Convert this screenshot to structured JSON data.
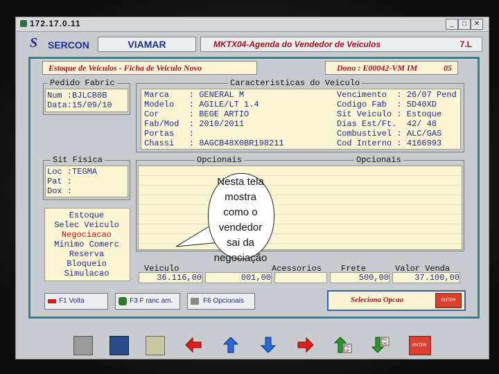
{
  "titlebar": {
    "text": "172.17.0.11",
    "min": "_",
    "max": "□",
    "close": "✕"
  },
  "app": {
    "logo_mark": "S",
    "logo_text": "SERCON",
    "company": "VIAMAR",
    "screen_title": "MKTX04-Agenda do Vendedor de Veiculos",
    "version": "7.L"
  },
  "header": {
    "ficha": "Estoque de Veiculos - Ficha de Veiculo Novo",
    "dono": "Dono : E00042-VM IM",
    "dono_num": "05"
  },
  "pedido": {
    "legend": "Pedido Fabric",
    "rows": [
      "Num :BJLCB0B",
      "Data:15/09/10"
    ]
  },
  "caracteristicas": {
    "legend": "Caracteristicas do Veiculo",
    "left": [
      "Marca    : GENERAL M",
      "Modelo   : AGILE/LT 1.4",
      "Cor      : BEGE ARTIO",
      "Fab/Mod  : 2010/2011",
      "Portas   :",
      "Chassi   : 8AGCB48X0BR198211"
    ],
    "right": [
      "Vencimento  : 26/07 Pend",
      "Codigo Fab  : 5D40XD",
      "Sit Veiculo : Estoque",
      "Dias Est/Ft.  42/ 48",
      "Combustivel : ALC/GAS",
      "Cod Interno : 4166993"
    ]
  },
  "sit_fisica": {
    "legend": "Sit Fisica",
    "rows": [
      "Loc :TEGMA",
      "Pat :",
      "Dox :"
    ]
  },
  "opcionais": {
    "legend_left": "Opcionais",
    "legend_right": "Opcionais"
  },
  "menu": {
    "items": [
      "Estoque",
      "Selec Veiculo",
      "Negociacao",
      "Minimo Comerc",
      "Reserva",
      "Bloqueio",
      "Simulacao"
    ],
    "selected_index": 2
  },
  "values": {
    "veiculo_label": "Veiculo",
    "veiculo_value": "36.116,00",
    "opcionais_value": "001,00",
    "acessorios_label": "Acessorios",
    "frete_label": "Frete",
    "frete_value": "500,00",
    "valor_label": "Valor Venda",
    "valor_value": "37.100,00"
  },
  "buttons": {
    "f1": "F1 Volta",
    "f3": "F3 F ranc am.",
    "f6": "F6 Opcionais",
    "selecione": "Seleciona Opcao",
    "enter": "ENTER"
  },
  "toolbar": {
    "pgup": "PG UP",
    "pgdn": "PG DN",
    "enter": "ENTER"
  },
  "annotation": {
    "line1": "Nesta tela",
    "line2": "mostra",
    "line3": "como o",
    "line4": "vendedor",
    "line5": "sai da",
    "line6": "negociação"
  }
}
